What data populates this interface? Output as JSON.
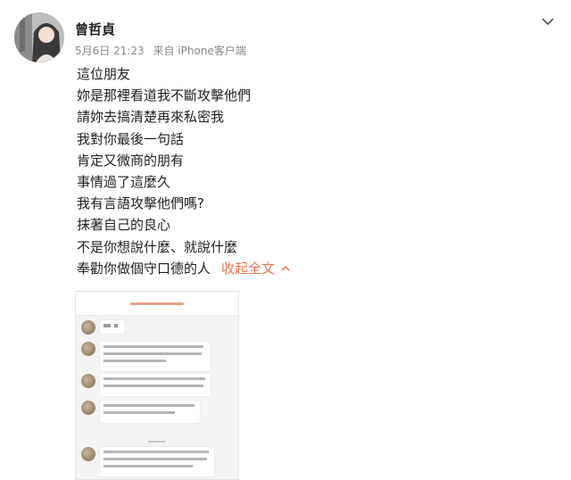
{
  "post": {
    "author": "曾哲貞",
    "date": "5月6日 21:23",
    "source": "来自 iPhone客户端",
    "lines": [
      "這位朋友",
      "妳是那裡看道我不斷攻擊他們",
      "請妳去搞清楚再來私密我",
      "我對你最後一句話",
      "肯定又微商的朋有",
      "事情過了這麼久",
      "我有言語攻擊他們嗎?",
      "抹著自己的良心",
      "不是你想說什麼、就說什麼",
      "奉勸你做個守口德的人"
    ],
    "collapse_label": "收起全文"
  },
  "colors": {
    "link": "#eb7350",
    "meta": "#8a8a8a",
    "text": "#222222"
  },
  "icons": {
    "chevron": "chevron-down-icon",
    "caret": "caret-up-icon"
  }
}
